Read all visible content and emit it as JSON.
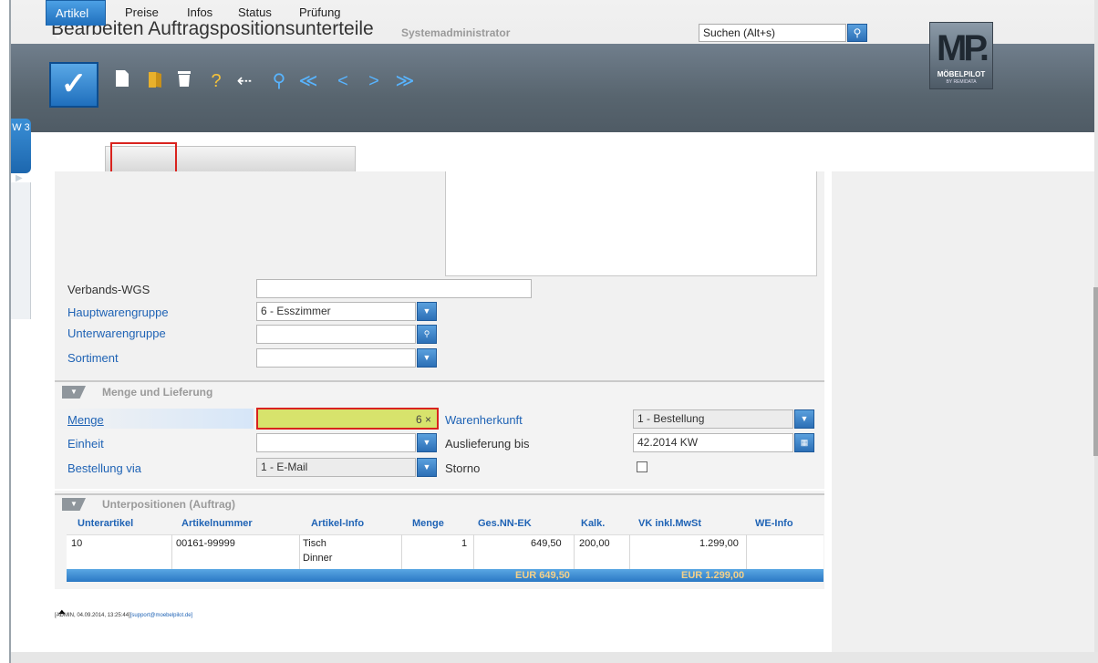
{
  "header": {
    "title": "Bearbeiten Auftragspositionsunterteile",
    "subtitle": "Systemadministrator",
    "search_placeholder": "Suchen (Alt+s)",
    "logo_text": "MP.",
    "logo_label": "MÖBELPILOT",
    "logo_sub": "BY REMIDATA"
  },
  "toolbar": {
    "icons": [
      "save-check-icon",
      "new-document-icon",
      "open-folder-icon",
      "delete-icon",
      "help-icon",
      "back-icon",
      "search-icon",
      "first-icon",
      "previous-icon",
      "next-icon",
      "last-icon"
    ],
    "help_glyph": "?",
    "back_glyph": "⇠",
    "first_glyph": "≪",
    "prev_glyph": "<",
    "next_glyph": ">",
    "last_glyph": "≫"
  },
  "side_tab": {
    "label": "W 3"
  },
  "tabs": [
    {
      "label": "Artikel *",
      "active": true
    },
    {
      "label": "Preise"
    },
    {
      "label": "Infos"
    },
    {
      "label": "Status"
    },
    {
      "label": "Prüfung"
    }
  ],
  "form": {
    "verbands_wgs": {
      "label": "Verbands-WGS",
      "value": ""
    },
    "hauptwarengruppe": {
      "label": "Hauptwarengruppe",
      "value": "6 - Esszimmer"
    },
    "unterwarengruppe": {
      "label": "Unterwarengruppe",
      "value": ""
    },
    "sortiment": {
      "label": "Sortiment",
      "value": ""
    }
  },
  "menge_section": {
    "title": "Menge und Lieferung",
    "menge": {
      "label": "Menge",
      "value": "6 ×"
    },
    "einheit": {
      "label": "Einheit",
      "value": ""
    },
    "bestellung_via": {
      "label": "Bestellung via",
      "value": "1 - E-Mail"
    },
    "warenherkunft": {
      "label": "Warenherkunft",
      "value": "1 - Bestellung"
    },
    "auslieferung_bis": {
      "label": "Auslieferung bis",
      "value": "42.2014 KW"
    },
    "storno": {
      "label": "Storno",
      "checked": false
    }
  },
  "unterpositionen": {
    "title": "Unterpositionen (Auftrag)",
    "columns": [
      "Unterartikel",
      "Artikelnummer",
      "Artikel-Info",
      "Menge",
      "Ges.NN-EK",
      "Kalk.",
      "VK inkl.MwSt",
      "WE-Info"
    ],
    "rows": [
      {
        "unterartikel": "10",
        "artikelnummer": "00161-99999",
        "artikel_info_1": "Tisch",
        "artikel_info_2": "Dinner",
        "menge": "1",
        "ges_nn_ek": "649,50",
        "kalk": "200,00",
        "vk": "1.299,00",
        "we_info": ""
      }
    ],
    "totals": {
      "ges_nn_ek": "EUR 649,50",
      "vk": "EUR 1.299,00"
    }
  },
  "footer": {
    "arrow": "🡑",
    "text": "[ADMIN, 04.09.2014, 13:25:44]",
    "email": "[support@moebelpilot.de]"
  },
  "colors": {
    "accent": "#1f6fbd",
    "highlight": "#d9231e",
    "menge_field": "#d7e36c"
  }
}
